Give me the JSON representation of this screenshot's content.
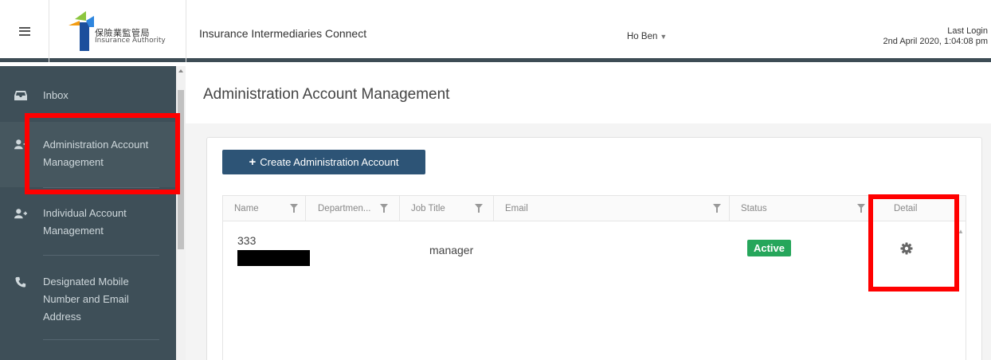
{
  "header": {
    "logo_zh": "保險業監管局",
    "logo_en": "Insurance Authority",
    "app_title": "Insurance Intermediaries Connect",
    "user_name": "Ho Ben",
    "last_login_label": "Last Login",
    "last_login_value": "2nd April 2020, 1:04:08 pm"
  },
  "sidebar": {
    "items": [
      {
        "label": "Inbox",
        "icon": "inbox-icon"
      },
      {
        "label": "Administration Account Management",
        "icon": "add-user-icon"
      },
      {
        "label": "Individual Account Management",
        "icon": "add-user-icon"
      },
      {
        "label": "Designated Mobile Number and Email Address",
        "icon": "phone-icon"
      }
    ]
  },
  "page": {
    "title": "Administration Account Management",
    "create_button": "Create Administration Account"
  },
  "table": {
    "columns": [
      "Name",
      "Departmen...",
      "Job Title",
      "Email",
      "Status",
      "Detail"
    ],
    "rows": [
      {
        "name": "333",
        "department": "",
        "job_title": "manager",
        "email": "",
        "status": "Active"
      }
    ]
  },
  "colors": {
    "sidebar_bg": "#3e4f58",
    "primary_button": "#2d5476",
    "status_active": "#26a65b",
    "highlight": "#ff0000"
  }
}
